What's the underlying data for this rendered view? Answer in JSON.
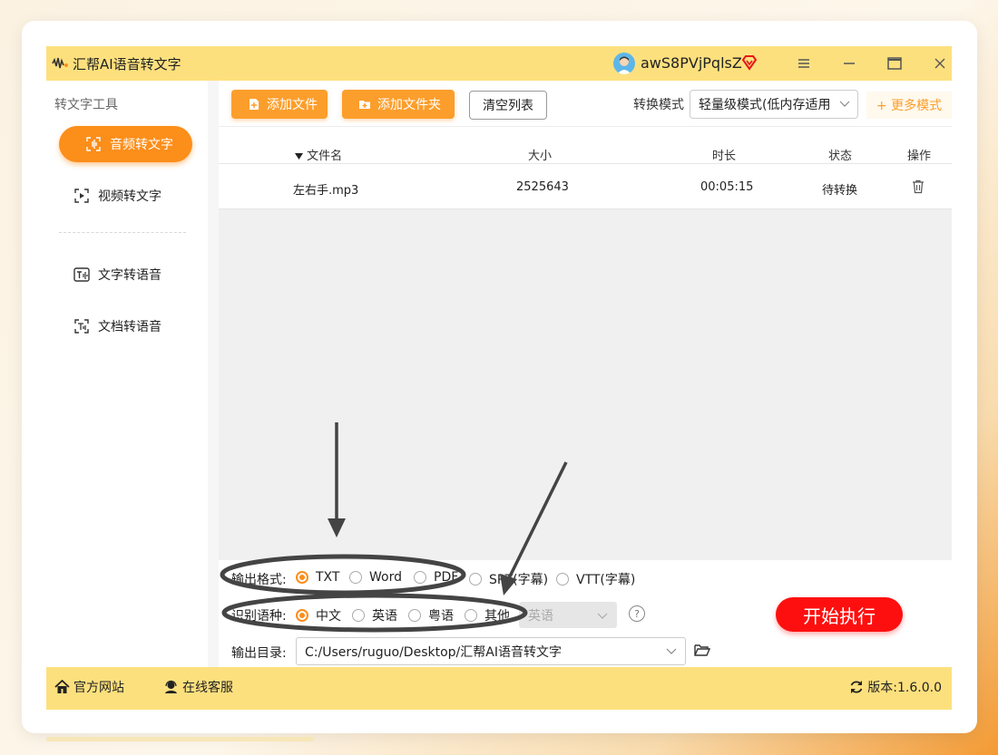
{
  "app": {
    "title": "汇帮AI语音转文字"
  },
  "user": {
    "name": "awS8PVjPqlsZ"
  },
  "sidebar": {
    "heading": "转文字工具",
    "items": [
      {
        "label": "音频转文字"
      },
      {
        "label": "视频转文字"
      },
      {
        "label": "文字转语音"
      },
      {
        "label": "文档转语音"
      }
    ]
  },
  "toolbar": {
    "add_file": "添加文件",
    "add_folder": "添加文件夹",
    "clear_list": "清空列表",
    "mode_label": "转换模式",
    "mode_value": "轻量级模式(低内存适用",
    "more_modes": "+ 更多模式"
  },
  "table": {
    "headers": [
      "文件名",
      "大小",
      "时长",
      "状态",
      "操作"
    ],
    "rows": [
      {
        "name": "左右手.mp3",
        "size": "2525643",
        "duration": "00:05:15",
        "status": "待转换"
      }
    ]
  },
  "output_format": {
    "label": "输出格式:",
    "options": [
      "TXT",
      "Word",
      "PDF",
      "SRT(字幕)",
      "VTT(字幕)"
    ],
    "selected": "TXT"
  },
  "language": {
    "label": "识别语种:",
    "options": [
      "中文",
      "英语",
      "粤语",
      "其他"
    ],
    "selected": "中文",
    "other_select": "英语"
  },
  "output_dir": {
    "label": "输出目录:",
    "value": "C:/Users/ruguo/Desktop/汇帮AI语音转文字"
  },
  "start_button": "开始执行",
  "footer": {
    "website": "官方网站",
    "support": "在线客服",
    "version": "版本:1.6.0.0"
  },
  "colors": {
    "accent": "#fc8e1a",
    "titlebar": "#fde07e",
    "start": "#fe0f0f"
  }
}
